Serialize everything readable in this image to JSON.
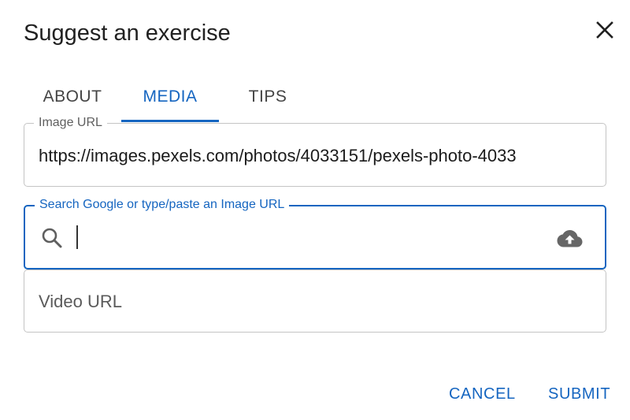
{
  "dialog": {
    "title": "Suggest an exercise"
  },
  "tabs": [
    {
      "label": "ABOUT",
      "active": false
    },
    {
      "label": "MEDIA",
      "active": true
    },
    {
      "label": "TIPS",
      "active": false
    }
  ],
  "fields": {
    "image_url": {
      "label": "Image URL",
      "value": "https://images.pexels.com/photos/4033151/pexels-photo-4033"
    },
    "image_search": {
      "label": "Search Google or type/paste an Image URL",
      "value": ""
    },
    "video_url": {
      "placeholder": "Video URL"
    }
  },
  "actions": {
    "cancel_label": "CANCEL",
    "submit_label": "SUBMIT"
  },
  "icons": {
    "close": "close-icon",
    "search": "search-icon",
    "upload": "cloud-upload-icon"
  },
  "colors": {
    "accent": "#1565c0",
    "text": "#212121",
    "border": "#c4c4c4"
  }
}
